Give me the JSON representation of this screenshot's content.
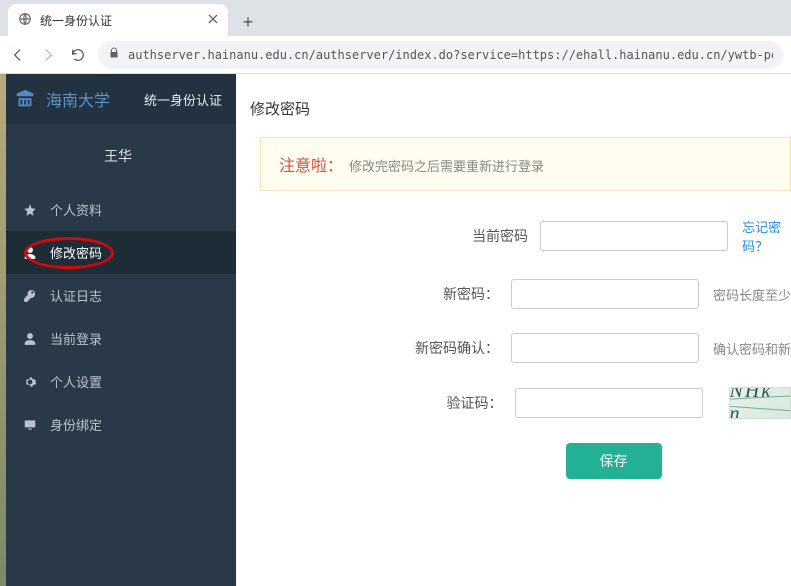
{
  "browser": {
    "tab_title": "统一身份认证",
    "url": "authserver.hainanu.edu.cn/authserver/index.do?service=https://ehall.hainanu.edu.cn/ywtb-port"
  },
  "brand": {
    "university": "海南大学",
    "system": "统一身份认证"
  },
  "user": {
    "name": "王华"
  },
  "sidebar": {
    "items": [
      {
        "label": "个人资料"
      },
      {
        "label": "修改密码"
      },
      {
        "label": "认证日志"
      },
      {
        "label": "当前登录"
      },
      {
        "label": "个人设置"
      },
      {
        "label": "身份绑定"
      }
    ]
  },
  "page": {
    "title": "修改密码",
    "notice_title": "注意啦：",
    "notice_body": "修改完密码之后需要重新进行登录"
  },
  "form": {
    "current_label": "当前密码",
    "forgot_link": "忘记密码？",
    "new_label": "新密码：",
    "new_hint": "密码长度至少",
    "confirm_label": "新密码确认：",
    "confirm_hint": "确认密码和新",
    "captcha_label": "验证码：",
    "captcha_text": "NHk n",
    "save": "保存"
  }
}
